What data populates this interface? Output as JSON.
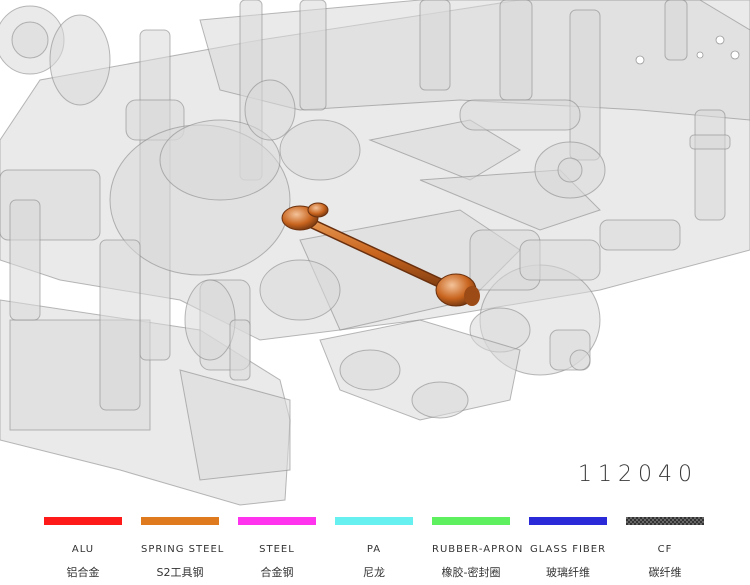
{
  "part_number": "112040",
  "highlight_color": "#c8641e",
  "legend": [
    {
      "en": "ALU",
      "cn": "铝合金",
      "color": "#ff1a1a"
    },
    {
      "en": "SPRING STEEL",
      "cn": "S2工具钢",
      "color": "#e07a1e"
    },
    {
      "en": "STEEL",
      "cn": "合金钢",
      "color": "#ff33ee"
    },
    {
      "en": "PA",
      "cn": "尼龙",
      "color": "#66f0f0"
    },
    {
      "en": "RUBBER-APRON",
      "cn": "橡胶-密封圈",
      "color": "#5ef05e"
    },
    {
      "en": "GLASS FIBER",
      "cn": "玻璃纤维",
      "color": "#2a2ad8"
    },
    {
      "en": "CF",
      "cn": "碳纤维",
      "color": "#333333"
    }
  ]
}
